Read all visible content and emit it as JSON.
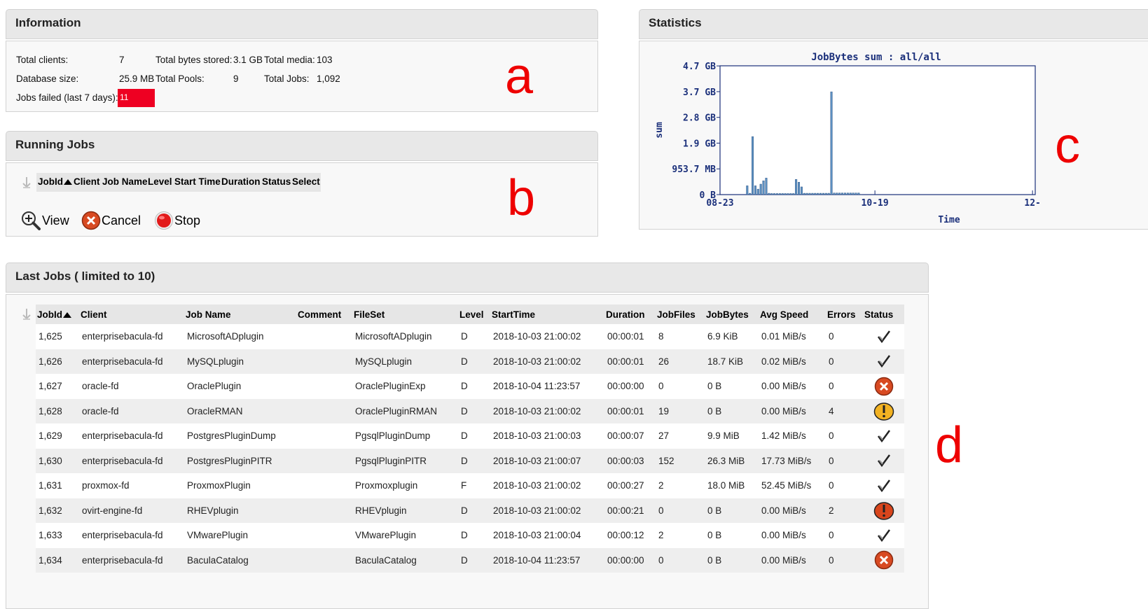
{
  "information": {
    "title": "Information",
    "total_clients_label": "Total clients:",
    "total_clients": "7",
    "total_bytes_label": "Total bytes stored:",
    "total_bytes": "3.1 GB",
    "total_media_label": "Total media:",
    "total_media": "103",
    "db_size_label": "Database size:",
    "db_size": "25.9 MB",
    "total_pools_label": "Total Pools:",
    "total_pools": "9",
    "total_jobs_label": "Total Jobs:",
    "total_jobs": "1,092",
    "jobs_failed_label": "Jobs failed (last 7 days):",
    "jobs_failed": "11",
    "annotation": "a"
  },
  "running_jobs": {
    "title": "Running Jobs",
    "columns": [
      "JobId",
      "Client",
      "Job Name",
      "Level",
      "Start Time",
      "Duration",
      "Status",
      "Select"
    ],
    "buttons": {
      "view": "View",
      "cancel": "Cancel",
      "stop": "Stop"
    },
    "annotation": "b"
  },
  "statistics": {
    "title": "Statistics",
    "annotation": "c"
  },
  "chart_data": {
    "type": "bar",
    "title": "JobBytes sum : all/all",
    "xlabel": "Time",
    "ylabel": "sum",
    "y_ticks": [
      "0 B",
      "953.7 MB",
      "1.9 GB",
      "2.8 GB",
      "3.7 GB",
      "4.7 GB"
    ],
    "x_ticks": [
      "08-23",
      "10-19",
      "12-"
    ],
    "ylim_gb": [
      0,
      4.66
    ],
    "series_color": "#5b8fc0",
    "x": [
      "09-02",
      "09-03",
      "09-04",
      "09-05",
      "09-06",
      "09-07",
      "09-08",
      "09-09",
      "09-10",
      "09-11",
      "09-12",
      "09-13",
      "09-14",
      "09-15",
      "09-16",
      "09-17",
      "09-18",
      "09-19",
      "09-20",
      "09-21",
      "09-22",
      "09-23",
      "09-24",
      "09-25",
      "09-26",
      "09-27",
      "09-28",
      "09-29",
      "09-30",
      "10-01",
      "10-02",
      "10-03",
      "10-04",
      "10-05",
      "10-06",
      "10-07",
      "10-08",
      "10-09",
      "10-10",
      "10-11",
      "10-12",
      "10-13",
      "10-14"
    ],
    "values_gb": [
      0.32,
      0.05,
      2.1,
      0.32,
      0.2,
      0.38,
      0.5,
      0.6,
      0.05,
      0.04,
      0.04,
      0.04,
      0.04,
      0.04,
      0.04,
      0.04,
      0.04,
      0.04,
      0.55,
      0.45,
      0.28,
      0.05,
      0.05,
      0.05,
      0.05,
      0.05,
      0.05,
      0.05,
      0.05,
      0.05,
      0.05,
      3.72,
      0.06,
      0.06,
      0.06,
      0.06,
      0.06,
      0.06,
      0.06,
      0.06,
      0.06,
      0.06,
      0.0
    ]
  },
  "last_jobs": {
    "title": "Last Jobs ( limited to 10)",
    "annotation": "d",
    "columns": [
      "JobId",
      "Client",
      "Job Name",
      "Comment",
      "FileSet",
      "Level",
      "StartTime",
      "Duration",
      "JobFiles",
      "JobBytes",
      "Avg Speed",
      "Errors",
      "Status"
    ],
    "rows": [
      {
        "jobid": "1,625",
        "client": "enterprisebacula-fd",
        "jobname": "MicrosoftADplugin",
        "comment": "",
        "fileset": "MicrosoftADplugin",
        "level": "D",
        "start": "2018-10-03 21:00:02",
        "duration": "00:00:01",
        "files": "8",
        "bytes": "6.9 KiB",
        "speed": "0.01 MiB/s",
        "errors": "0",
        "status": "ok"
      },
      {
        "jobid": "1,626",
        "client": "enterprisebacula-fd",
        "jobname": "MySQLplugin",
        "comment": "",
        "fileset": "MySQLplugin",
        "level": "D",
        "start": "2018-10-03 21:00:02",
        "duration": "00:00:01",
        "files": "26",
        "bytes": "18.7 KiB",
        "speed": "0.02 MiB/s",
        "errors": "0",
        "status": "ok"
      },
      {
        "jobid": "1,627",
        "client": "oracle-fd",
        "jobname": "OraclePlugin",
        "comment": "",
        "fileset": "OraclePluginExp",
        "level": "D",
        "start": "2018-10-04 11:23:57",
        "duration": "00:00:00",
        "files": "0",
        "bytes": "0 B",
        "speed": "0.00 MiB/s",
        "errors": "0",
        "status": "error"
      },
      {
        "jobid": "1,628",
        "client": "oracle-fd",
        "jobname": "OracleRMAN",
        "comment": "",
        "fileset": "OraclePluginRMAN",
        "level": "D",
        "start": "2018-10-03 21:00:02",
        "duration": "00:00:01",
        "files": "19",
        "bytes": "0 B",
        "speed": "0.00 MiB/s",
        "errors": "4",
        "status": "warning"
      },
      {
        "jobid": "1,629",
        "client": "enterprisebacula-fd",
        "jobname": "PostgresPluginDump",
        "comment": "",
        "fileset": "PgsqlPluginDump",
        "level": "D",
        "start": "2018-10-03 21:00:03",
        "duration": "00:00:07",
        "files": "27",
        "bytes": "9.9 MiB",
        "speed": "1.42 MiB/s",
        "errors": "0",
        "status": "ok"
      },
      {
        "jobid": "1,630",
        "client": "enterprisebacula-fd",
        "jobname": "PostgresPluginPITR",
        "comment": "",
        "fileset": "PgsqlPluginPITR",
        "level": "D",
        "start": "2018-10-03 21:00:07",
        "duration": "00:00:03",
        "files": "152",
        "bytes": "26.3 MiB",
        "speed": "17.73 MiB/s",
        "errors": "0",
        "status": "ok"
      },
      {
        "jobid": "1,631",
        "client": "proxmox-fd",
        "jobname": "ProxmoxPlugin",
        "comment": "",
        "fileset": "Proxmoxplugin",
        "level": "F",
        "start": "2018-10-03 21:00:02",
        "duration": "00:00:27",
        "files": "2",
        "bytes": "18.0 MiB",
        "speed": "52.45 MiB/s",
        "errors": "0",
        "status": "ok"
      },
      {
        "jobid": "1,632",
        "client": "ovirt-engine-fd",
        "jobname": "RHEVplugin",
        "comment": "",
        "fileset": "RHEVplugin",
        "level": "D",
        "start": "2018-10-03 21:00:02",
        "duration": "00:00:21",
        "files": "0",
        "bytes": "0 B",
        "speed": "0.00 MiB/s",
        "errors": "2",
        "status": "error-warning"
      },
      {
        "jobid": "1,633",
        "client": "enterprisebacula-fd",
        "jobname": "VMwarePlugin",
        "comment": "",
        "fileset": "VMwarePlugin",
        "level": "D",
        "start": "2018-10-03 21:00:04",
        "duration": "00:00:12",
        "files": "2",
        "bytes": "0 B",
        "speed": "0.00 MiB/s",
        "errors": "0",
        "status": "ok"
      },
      {
        "jobid": "1,634",
        "client": "enterprisebacula-fd",
        "jobname": "BaculaCatalog",
        "comment": "",
        "fileset": "BaculaCatalog",
        "level": "D",
        "start": "2018-10-04 11:23:57",
        "duration": "00:00:00",
        "files": "0",
        "bytes": "0 B",
        "speed": "0.00 MiB/s",
        "errors": "0",
        "status": "error"
      }
    ]
  },
  "icons": {
    "sort_handle": "sort-handle-icon",
    "view": "zoom-in-icon",
    "cancel": "cancel-icon",
    "stop": "stop-icon",
    "ok": "checkmark-icon",
    "error": "error-icon",
    "warning": "warning-icon"
  }
}
